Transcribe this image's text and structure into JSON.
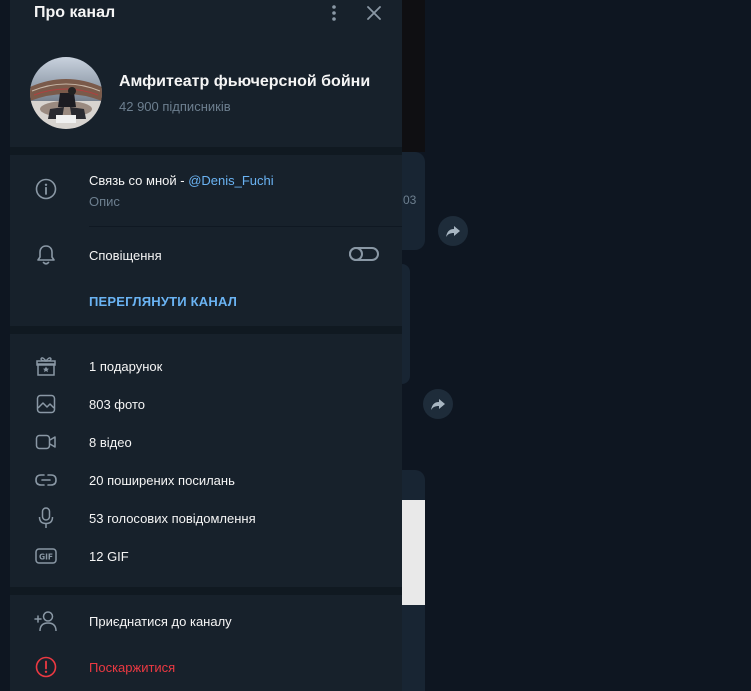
{
  "header": {
    "title": "Про канал"
  },
  "channel": {
    "name": "Амфитеатр фьючерсной бойни",
    "subscribers": "42 900 підписників"
  },
  "info": {
    "description_prefix": "Связь со мной - ",
    "description_handle": "@Denis_Fuchi",
    "description_label": "Опис"
  },
  "notifications": {
    "label": "Сповіщення",
    "enabled": false
  },
  "view_channel_label": "ПЕРЕГЛЯНУТИ КАНАЛ",
  "media": [
    {
      "icon": "gift-icon",
      "label": "1 подарунок"
    },
    {
      "icon": "photo-icon",
      "label": "803 фото"
    },
    {
      "icon": "video-icon",
      "label": "8 відео"
    },
    {
      "icon": "link-icon",
      "label": "20 поширених посилань"
    },
    {
      "icon": "microphone-icon",
      "label": "53 голосових повідомлення"
    },
    {
      "icon": "gif-icon",
      "label": "12 GIF"
    }
  ],
  "actions": {
    "join": "Приєднатися до каналу",
    "report": "Поскаржитися"
  },
  "background": {
    "time_fragment": "03"
  },
  "colors": {
    "panel": "#17212b",
    "accent": "#6ab3f3",
    "danger": "#ec3942",
    "secondary_text": "#6d7f8f"
  }
}
